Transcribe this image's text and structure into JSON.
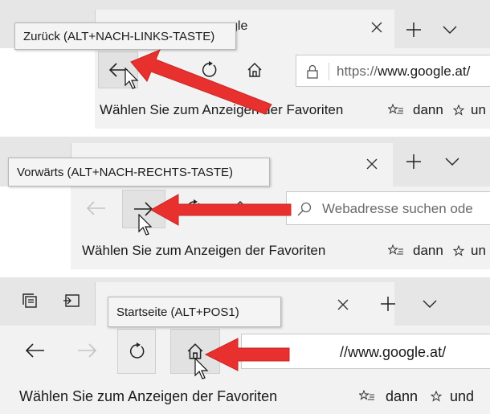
{
  "panel_back": {
    "tab_title_fragment": "gle",
    "tooltip": "Zurück (ALT+NACH-LINKS-TASTE)",
    "address_prefix": "https://",
    "address_domain": "www.google.at/",
    "favorites_hint": "Wählen Sie zum Anzeigen der Favoriten",
    "favorites_hint_tail": "dann",
    "favorites_hint_end": "un"
  },
  "panel_forward": {
    "tooltip": "Vorwärts (ALT+NACH-RECHTS-TASTE)",
    "address_placeholder": "Webadresse suchen ode",
    "favorites_hint": "Wählen Sie zum Anzeigen der Favoriten",
    "favorites_hint_tail": "dann",
    "favorites_hint_end": "un"
  },
  "panel_home": {
    "tooltip": "Startseite (ALT+POS1)",
    "address_fragment": "//www.google.at/",
    "favorites_hint": "Wählen Sie zum Anzeigen der Favoriten",
    "favorites_hint_tail": "dann",
    "favorites_hint_end": "und"
  },
  "icons": {
    "back": "back-arrow-icon",
    "forward": "forward-arrow-icon",
    "refresh": "refresh-icon",
    "home": "home-icon",
    "new_tab": "plus-icon",
    "close_tab": "close-icon",
    "tab_list": "chevron-down-icon",
    "lock": "lock-icon",
    "search": "search-icon",
    "favorites_star_list": "star-list-icon",
    "favorites_star": "star-icon",
    "set_tabs_aside": "tabs-aside-icon",
    "show_tabs_aside": "show-tabs-icon",
    "pointer": "mouse-pointer-icon",
    "annotation_arrow": "red-arrow-icon"
  },
  "colors": {
    "annotation_red": "#e8312f",
    "tab_strip": "#e6e6e6",
    "toolbar": "#f2f2f2",
    "pressed_button": "#e2e2e2",
    "disabled_icon": "#c4c4c4"
  }
}
